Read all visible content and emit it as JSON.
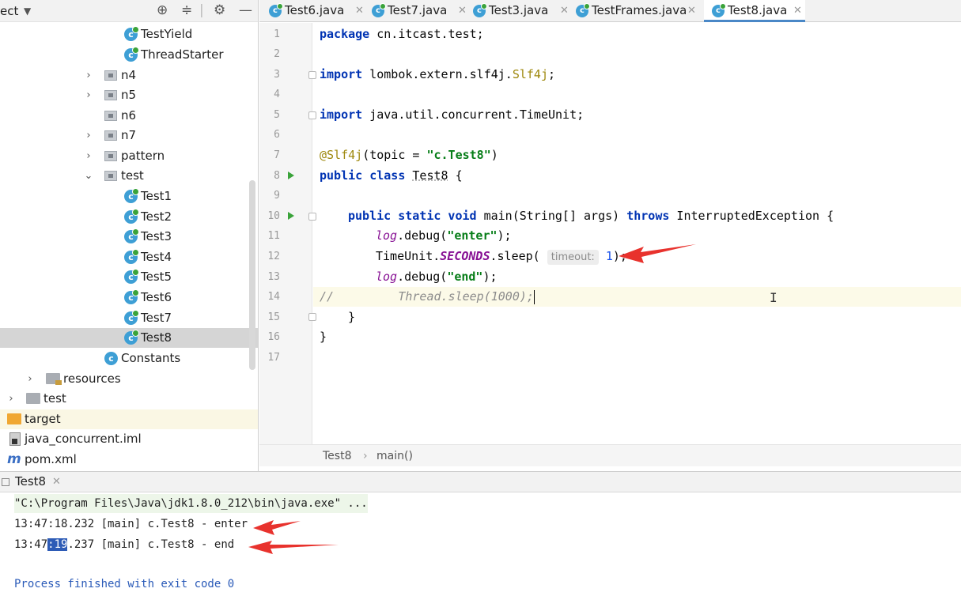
{
  "project_panel": {
    "title": "ect",
    "tree": [
      {
        "label": "TestYield",
        "kind": "class"
      },
      {
        "label": "ThreadStarter",
        "kind": "class"
      },
      {
        "label": "n4",
        "kind": "package"
      },
      {
        "label": "n5",
        "kind": "package"
      },
      {
        "label": "n6",
        "kind": "package"
      },
      {
        "label": "n7",
        "kind": "package"
      },
      {
        "label": "pattern",
        "kind": "package"
      },
      {
        "label": "test",
        "kind": "package"
      },
      {
        "label": "Test1",
        "kind": "class"
      },
      {
        "label": "Test2",
        "kind": "class"
      },
      {
        "label": "Test3",
        "kind": "class"
      },
      {
        "label": "Test4",
        "kind": "class"
      },
      {
        "label": "Test5",
        "kind": "class"
      },
      {
        "label": "Test6",
        "kind": "class"
      },
      {
        "label": "Test7",
        "kind": "class"
      },
      {
        "label": "Test8",
        "kind": "class",
        "selected": true
      },
      {
        "label": "Constants",
        "kind": "class"
      },
      {
        "label": "resources",
        "kind": "resources-folder"
      },
      {
        "label": "test",
        "kind": "folder"
      },
      {
        "label": "target",
        "kind": "excluded-folder"
      },
      {
        "label": "java_concurrent.iml",
        "kind": "iml-file"
      },
      {
        "label": "pom.xml",
        "kind": "maven-file"
      }
    ]
  },
  "editor_tabs": [
    {
      "label": "Test6.java",
      "active": false
    },
    {
      "label": "Test7.java",
      "active": false
    },
    {
      "label": "Test3.java",
      "active": false
    },
    {
      "label": "TestFrames.java",
      "active": false
    },
    {
      "label": "Test8.java",
      "active": true
    }
  ],
  "editor": {
    "line_numbers": [
      "1",
      "2",
      "3",
      "4",
      "5",
      "6",
      "7",
      "8",
      "9",
      "10",
      "11",
      "12",
      "13",
      "14",
      "15",
      "16",
      "17"
    ],
    "current_line": 14,
    "code": {
      "l1_kw": "package",
      "l1_rest": " cn.itcast.test;",
      "l3_kw": "import",
      "l3_rest": " lombok.extern.slf4j.",
      "l3_cls": "Slf4j",
      "l3_end": ";",
      "l5_kw": "import",
      "l5_rest": " java.util.concurrent.TimeUnit;",
      "l7_ann": "@Slf4j",
      "l7_mid": "(topic = ",
      "l7_str": "\"c.Test8\"",
      "l7_end": ")",
      "l8_kw": "public class",
      "l8_sp": " ",
      "l8_cls": "Test8",
      "l8_end": " {",
      "l10_kw1": "public static void",
      "l10_mid": " main(String[] args) ",
      "l10_kw2": "throws",
      "l10_end": " InterruptedException {",
      "l11_log": "log",
      "l11_mid": ".debug(",
      "l11_str": "\"enter\"",
      "l11_end": ");",
      "l12_a": "TimeUnit.",
      "l12_const": "SECONDS",
      "l12_b": ".sleep( ",
      "l12_hint": "timeout:",
      "l12_num": "1",
      "l12_end": ");",
      "l13_log": "log",
      "l13_mid": ".debug(",
      "l13_str": "\"end\"",
      "l13_end": ");",
      "l14_cmt1": "//",
      "l14_cmt2": "Thread.sleep(1000);",
      "l15": "}",
      "l16": "}"
    }
  },
  "breadcrumbs": [
    "Test8",
    "main()"
  ],
  "run_panel": {
    "tab_label": "Test8",
    "console": {
      "cmd": "\"C:\\Program Files\\Java\\jdk1.8.0_212\\bin\\java.exe\" ...",
      "line1": "13:47:18.232 [main] c.Test8 - enter",
      "line2_pre": "13:47",
      "line2_sel": ":19",
      "line2_post": ".237 [main] c.Test8 - end",
      "exit": "Process finished with exit code 0"
    }
  },
  "colors": {
    "keyword": "#0033b3",
    "string": "#067d17",
    "annotation": "#9e880d",
    "arrow": "#e8322d",
    "selection": "#2d5bb6"
  }
}
